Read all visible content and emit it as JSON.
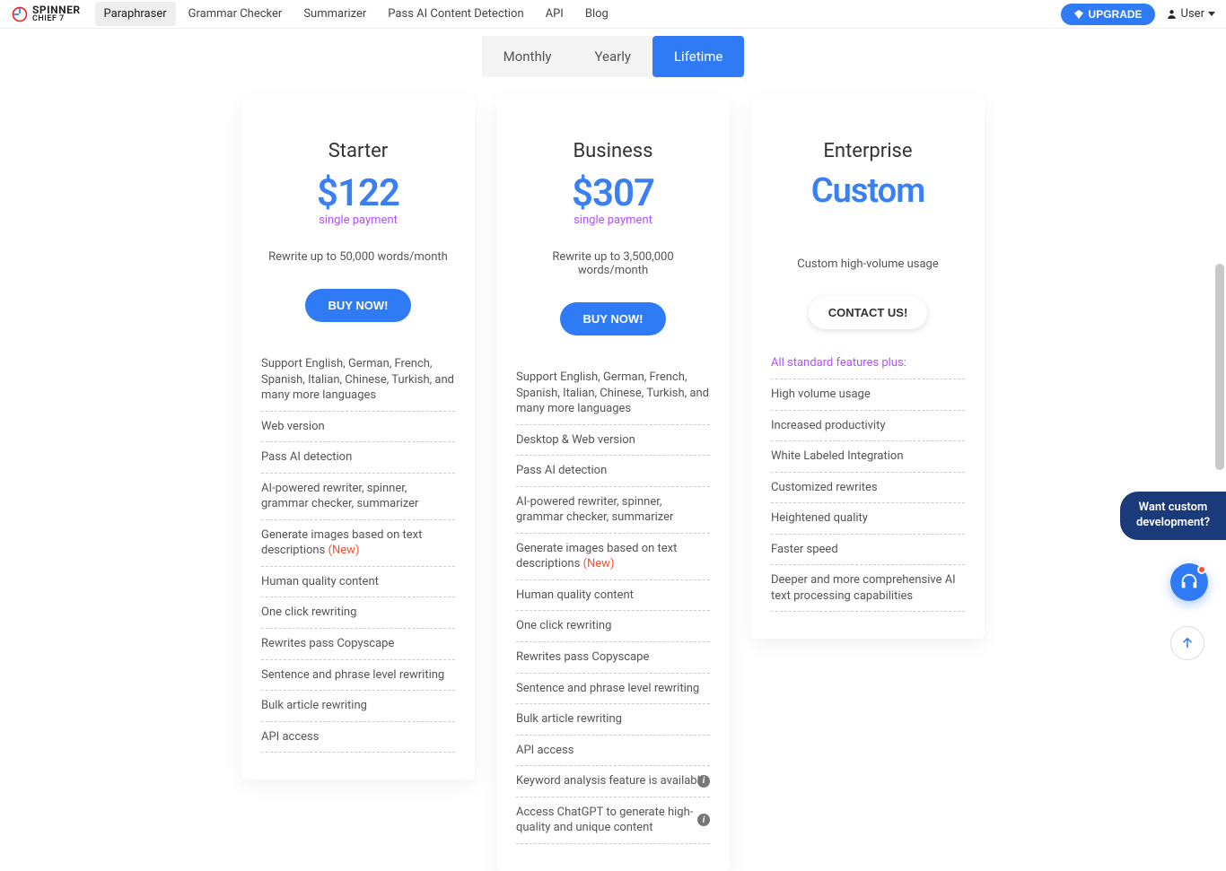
{
  "brand": {
    "name": "SPINNER",
    "sub": "CHIEF 7"
  },
  "nav": {
    "paraphraser": "Paraphraser",
    "grammar": "Grammar Checker",
    "summarizer": "Summarizer",
    "pass_ai": "Pass AI Content Detection",
    "api": "API",
    "blog": "Blog"
  },
  "header": {
    "upgrade": "UPGRADE",
    "user": "User"
  },
  "tabs": {
    "monthly": "Monthly",
    "yearly": "Yearly",
    "lifetime": "Lifetime"
  },
  "pricing": {
    "starter": {
      "tier": "Starter",
      "price": "$122",
      "period": "single payment",
      "limit": "Rewrite up to 50,000 words/month",
      "cta": "BUY NOW!",
      "features": [
        "Support English, German, French, Spanish, Italian, Chinese, Turkish, and many more languages",
        "Web version",
        "Pass AI detection",
        "AI-powered rewriter, spinner, grammar checker, summarizer",
        "Generate images based on text descriptions",
        "Human quality content",
        "One click rewriting",
        "Rewrites pass Copyscape",
        "Sentence and phrase level rewriting",
        "Bulk article rewriting",
        "API access"
      ],
      "new_tag": "(New)"
    },
    "business": {
      "tier": "Business",
      "price": "$307",
      "period": "single payment",
      "limit": "Rewrite up to 3,500,000 words/month",
      "cta": "BUY NOW!",
      "features": [
        "Support English, German, French, Spanish, Italian, Chinese, Turkish, and many more languages",
        "Desktop & Web version",
        "Pass AI detection",
        "AI-powered rewriter, spinner, grammar checker, summarizer",
        "Generate images based on text descriptions",
        "Human quality content",
        "One click rewriting",
        "Rewrites pass Copyscape",
        "Sentence and phrase level rewriting",
        "Bulk article rewriting",
        "API access",
        "Keyword analysis feature is available",
        "Access ChatGPT to generate high-quality and unique content"
      ],
      "new_tag": "(New)"
    },
    "enterprise": {
      "tier": "Enterprise",
      "price": "Custom",
      "limit": "Custom high-volume usage",
      "cta": "CONTACT US!",
      "plus_label": "All standard features plus:",
      "features": [
        "High volume usage",
        "Increased productivity",
        "White Labeled Integration",
        "Customized rewrites",
        "Heightened quality",
        "Faster speed",
        "Deeper and more comprehensive AI text processing capabilities"
      ]
    }
  },
  "float": {
    "tip_line1": "Want custom",
    "tip_line2": "development?"
  }
}
